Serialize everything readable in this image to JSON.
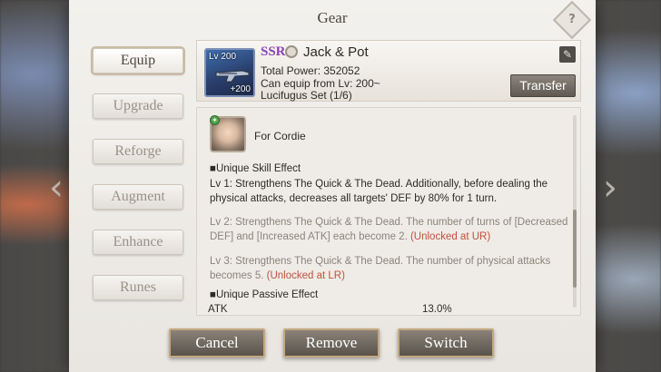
{
  "dialog": {
    "title": "Gear"
  },
  "nav": {
    "items": [
      {
        "label": "Equip",
        "active": true
      },
      {
        "label": "Upgrade",
        "active": false
      },
      {
        "label": "Reforge",
        "active": false
      },
      {
        "label": "Augment",
        "active": false
      },
      {
        "label": "Enhance",
        "active": false
      },
      {
        "label": "Runes",
        "active": false
      }
    ]
  },
  "gear": {
    "level": "Lv 200",
    "plus": "+200",
    "rarity": "SSR",
    "name": "Jack & Pot",
    "total_power": "Total Power: 352052",
    "equip_req": "Can equip from Lv: 200~",
    "set": "Lucifugus Set (1/6)",
    "transfer_label": "Transfer"
  },
  "description": {
    "owner": "For Cordie",
    "unique_skill_heading": "■Unique Skill Effect",
    "skill_lv1": "Lv 1: Strengthens The Quick & The Dead. Additionally, before dealing the physical attacks, decreases all targets' DEF by 80% for 1 turn.",
    "skill_lv2": "Lv 2: Strengthens The Quick & The Dead. The number of turns of [Decreased DEF] and [Increased ATK] each become 2.",
    "skill_lv2_lock": "(Unlocked at UR)",
    "skill_lv3": "Lv 3: Strengthens The Quick & The Dead. The number of physical attacks becomes 5.",
    "skill_lv3_lock": "(Unlocked at LR)",
    "passive_heading": "■Unique Passive Effect",
    "stat_label": "ATK",
    "stat_value": "13.0%"
  },
  "buttons": {
    "cancel": "Cancel",
    "remove": "Remove",
    "switch": "Switch"
  },
  "colors": {
    "rarity_ssr": "#8c3fb8",
    "locked": "#c0503d",
    "button_border": "#c3a87f"
  }
}
